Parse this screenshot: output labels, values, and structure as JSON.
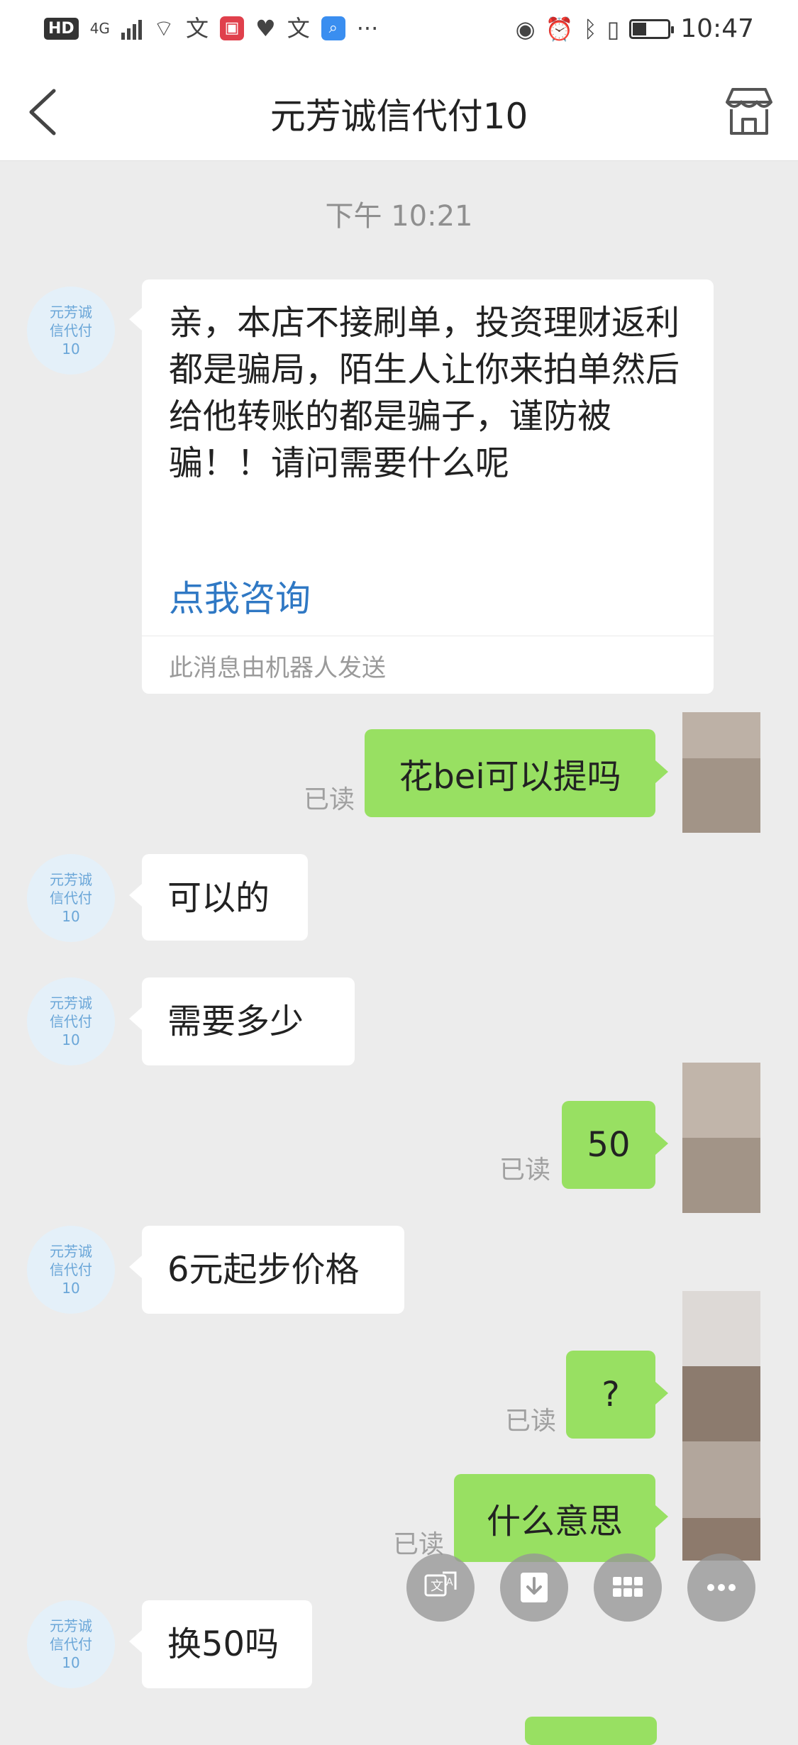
{
  "status_bar": {
    "left_badges": [
      "HD",
      "4G"
    ],
    "time": "10:47",
    "battery_fraction": 0.4
  },
  "header": {
    "title": "元芳诚信代付10"
  },
  "conversation": {
    "timestamp": "下午 10:21",
    "contact_avatar_text": "元芳诚\n信代付\n10",
    "robot_message": {
      "text": "亲，本店不接刷单，投资理财返利都是骗局，陌生人让你来拍单然后给他转账的都是骗子，谨防被骗！！请问需要什么呢",
      "link": "点我咨询",
      "footer": "此消息由机器人发送"
    },
    "messages": [
      {
        "side": "out",
        "text": "花bei可以提吗",
        "status": "已读"
      },
      {
        "side": "in",
        "text": "可以的"
      },
      {
        "side": "in",
        "text": "需要多少"
      },
      {
        "side": "out",
        "text": "50",
        "status": "已读"
      },
      {
        "side": "in",
        "text": "6元起步价格"
      },
      {
        "side": "out",
        "text": "?",
        "status": "已读"
      },
      {
        "side": "out",
        "text": "什么意思",
        "status": "已读"
      },
      {
        "side": "in",
        "text": "换50吗"
      }
    ]
  },
  "floating_actions": [
    {
      "icon": "translate-icon"
    },
    {
      "icon": "download-icon"
    },
    {
      "icon": "grid-icon"
    },
    {
      "icon": "more-icon"
    }
  ],
  "colors": {
    "incoming_bubble": "#ffffff",
    "outgoing_bubble": "#98e062",
    "background": "#ececec",
    "link": "#2f78c4"
  }
}
